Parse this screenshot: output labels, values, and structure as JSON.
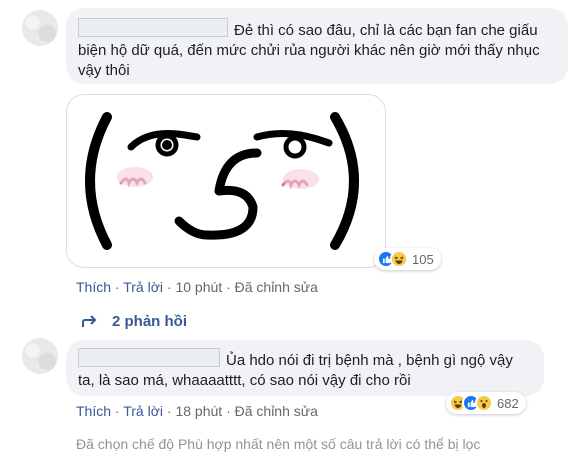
{
  "comment1": {
    "text": "Đẻ thì có sao đâu, chỉ là các bạn fan che giấu biện hộ dữ quá, đến mức chửi rủa người khác nên giờ mới thấy nhục vậy thôi",
    "sticker": {
      "left_paren": "(",
      "right_paren": ")",
      "blush_left": "ɯ",
      "blush_right": "ɯ",
      "nose": "ʖ"
    },
    "reactions": {
      "icons": [
        "like-icon",
        "haha-icon"
      ],
      "count": "105"
    },
    "actions": {
      "like": "Thích",
      "reply": "Trả lời",
      "time": "10 phút",
      "edited": "Đã chỉnh sửa",
      "sep": "·"
    },
    "replies_label": "2 phản hồi"
  },
  "comment2": {
    "text": "Ủa hdo nói đi trị bệnh mà , bệnh gì ngộ vậy ta, là sao má, whaaaatttt, có sao nói vậy đi cho rồi",
    "reactions": {
      "icons": [
        "haha-icon",
        "like-icon",
        "wow-icon"
      ],
      "count": "682"
    },
    "actions": {
      "like": "Thích",
      "reply": "Trả lời",
      "time": "18 phút",
      "edited": "Đã chỉnh sửa",
      "sep": "·"
    }
  },
  "footer_note": "Đã chọn chế độ Phù hợp nhất nên một số câu trả lời có thể bị lọc",
  "colors": {
    "bubble": "#f0f2f5",
    "link": "#385898",
    "meta": "#65676b",
    "like_blue": "#1877f2",
    "emoji_yellow": "#f7c948"
  }
}
